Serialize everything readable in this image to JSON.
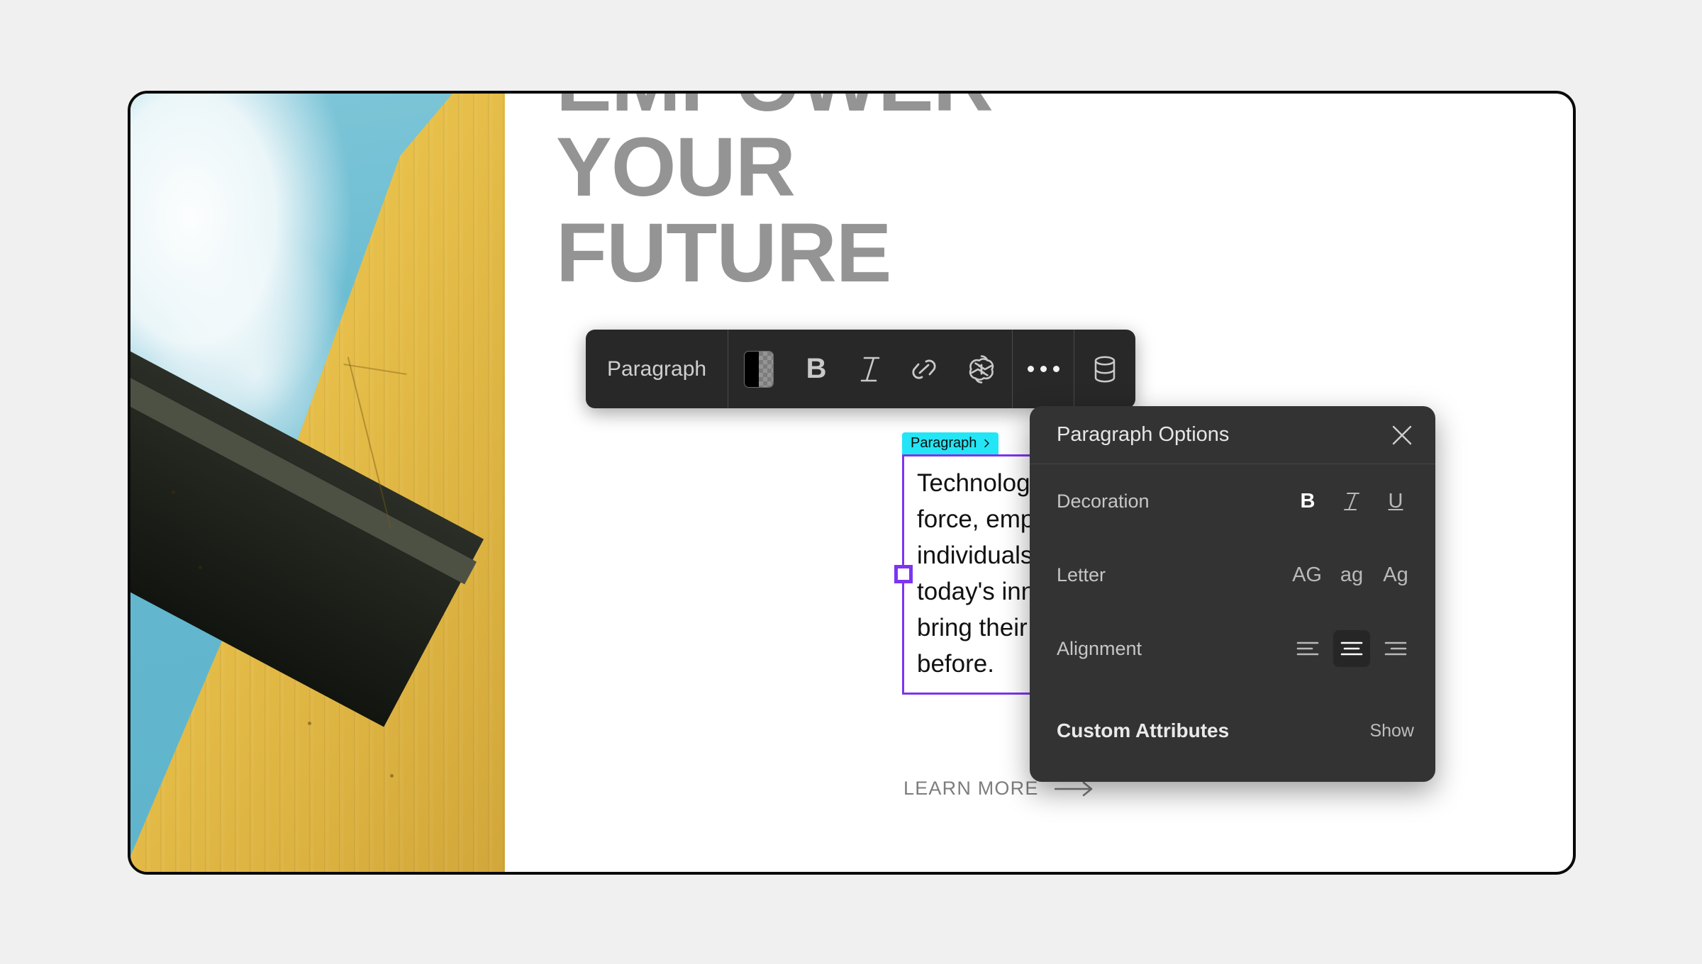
{
  "canvas": {
    "headline": "EMPOWER\nYOUR\nFUTURE",
    "paragraph_tag": "Paragraph",
    "paragraph_text": "Technology has become a powerful force, empowering creative individuals and industries alike. With today's innovative tools designers can bring their ideas to life like never before.",
    "cta_label": "LEARN MORE",
    "photo_alt": "yellow-wall-blue-sky-photo"
  },
  "toolbar": {
    "block_type_label": "Paragraph",
    "items": [
      {
        "name": "color-swatch",
        "label": ""
      },
      {
        "name": "bold-button",
        "label": "B"
      },
      {
        "name": "italic-button",
        "label": "I"
      },
      {
        "name": "link-button",
        "label": ""
      },
      {
        "name": "openai-button",
        "label": ""
      },
      {
        "name": "more-button",
        "label": ""
      },
      {
        "name": "database-button",
        "label": ""
      }
    ]
  },
  "panel": {
    "title": "Paragraph Options",
    "close_label": "Close",
    "rows": [
      {
        "label": "Decoration",
        "options": [
          {
            "label": "B",
            "active": true
          },
          {
            "label": "I",
            "active": false
          },
          {
            "label": "U",
            "active": false
          }
        ]
      },
      {
        "label": "Letter",
        "options": [
          {
            "label": "AG",
            "active": false
          },
          {
            "label": "ag",
            "active": false
          },
          {
            "label": "Ag",
            "active": false
          }
        ]
      },
      {
        "label": "Alignment",
        "options": [
          {
            "label": "align-left",
            "active": false
          },
          {
            "label": "align-center",
            "active": true
          },
          {
            "label": "align-right",
            "active": false
          }
        ]
      }
    ],
    "custom_attributes_label": "Custom Attributes",
    "custom_attributes_action": "Show"
  },
  "colors": {
    "page_background": "#f0f0f0",
    "canvas_background": "#ffffff",
    "canvas_border": "#0a0a0a",
    "selection_purple": "#7c35f0",
    "tag_cyan": "#22e6f5",
    "toolbar_background": "#282828",
    "panel_background": "#333333",
    "headline_gray": "#949494",
    "wall_yellow": "#e9c24c",
    "sky_blue": "#63b8cf"
  }
}
